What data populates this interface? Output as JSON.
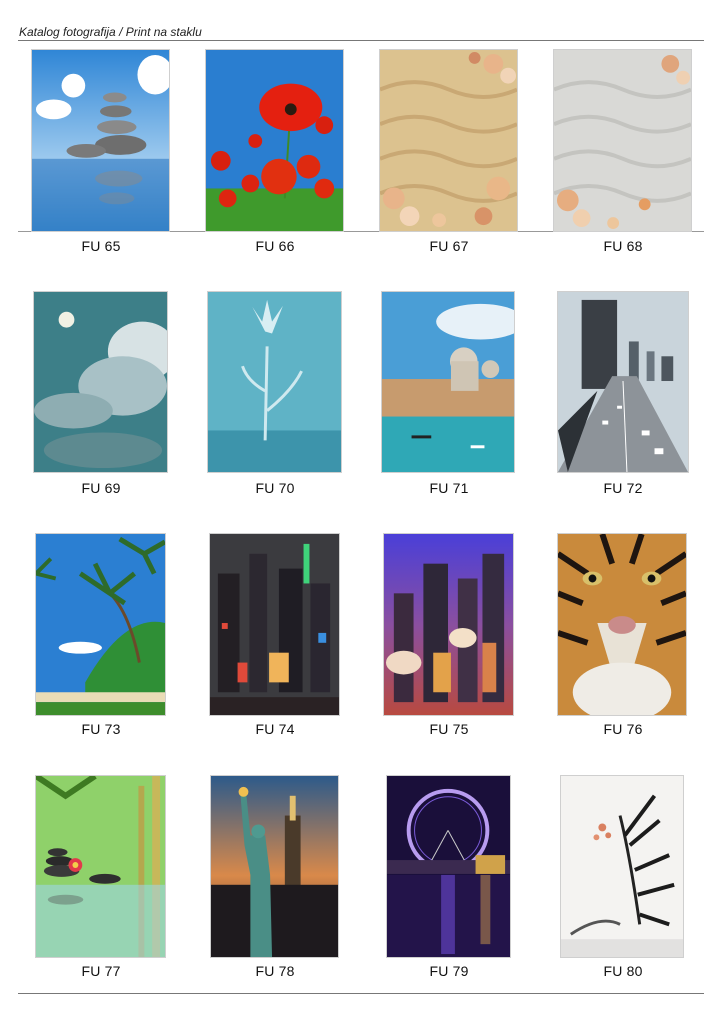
{
  "header": {
    "title": "Katalog fotografija / Print na staklu"
  },
  "items": [
    {
      "code": "FU 65",
      "icon": "zen-stones-image"
    },
    {
      "code": "FU 66",
      "icon": "poppies-image"
    },
    {
      "code": "FU 67",
      "icon": "sand-shells-image"
    },
    {
      "code": "FU 68",
      "icon": "grey-sand-shells-image"
    },
    {
      "code": "FU 69",
      "icon": "moon-clouds-image"
    },
    {
      "code": "FU 70",
      "icon": "water-flower-image"
    },
    {
      "code": "FU 71",
      "icon": "venice-image"
    },
    {
      "code": "FU 72",
      "icon": "highway-city-image"
    },
    {
      "code": "FU 73",
      "icon": "palm-beach-image"
    },
    {
      "code": "FU 74",
      "icon": "night-city-painting-image"
    },
    {
      "code": "FU 75",
      "icon": "city-painting-image"
    },
    {
      "code": "FU 76",
      "icon": "tiger-image"
    },
    {
      "code": "FU 77",
      "icon": "bamboo-stones-image"
    },
    {
      "code": "FU 78",
      "icon": "statue-of-liberty-image"
    },
    {
      "code": "FU 79",
      "icon": "london-eye-image"
    },
    {
      "code": "FU 80",
      "icon": "ink-bamboo-image"
    }
  ]
}
